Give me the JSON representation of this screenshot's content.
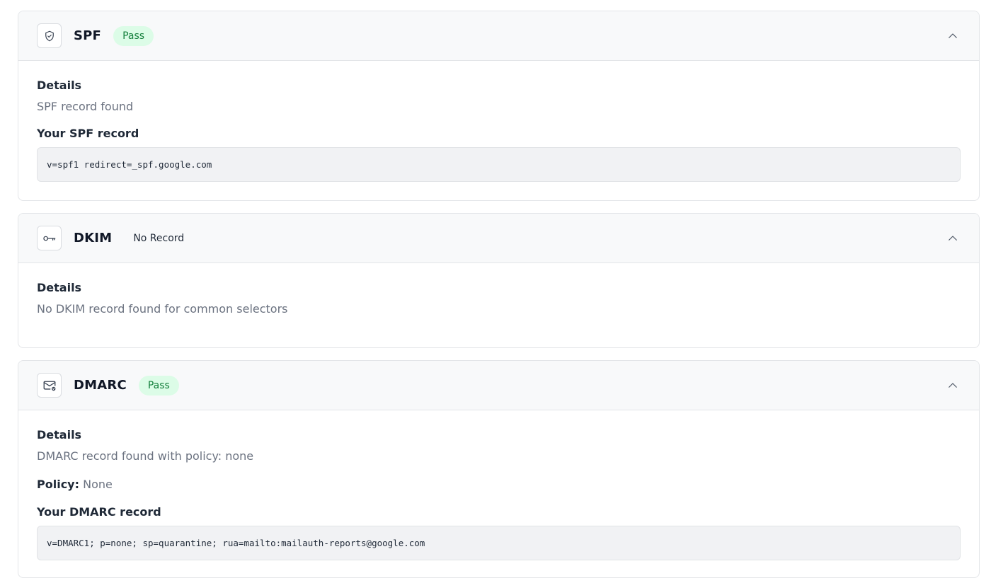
{
  "spf": {
    "title": "SPF",
    "icon": "shield-check-icon",
    "status": "Pass",
    "details_label": "Details",
    "details_text": "SPF record found",
    "record_label": "Your SPF record",
    "record_value": "v=spf1 redirect=_spf.google.com"
  },
  "dkim": {
    "title": "DKIM",
    "icon": "key-icon",
    "status": "No Record",
    "details_label": "Details",
    "details_text": "No DKIM record found for common selectors"
  },
  "dmarc": {
    "title": "DMARC",
    "icon": "mail-check-icon",
    "status": "Pass",
    "details_label": "Details",
    "details_text": "DMARC record found with policy: none",
    "policy_label": "Policy:",
    "policy_value": "None",
    "record_label": "Your DMARC record",
    "record_value": "v=DMARC1; p=none; sp=quarantine; rua=mailto:mailauth-reports@google.com"
  },
  "colors": {
    "pass_bg": "#dcfce7",
    "pass_text": "#15803d",
    "header_bg": "#f8f9fa",
    "border": "#e3e5e8"
  }
}
